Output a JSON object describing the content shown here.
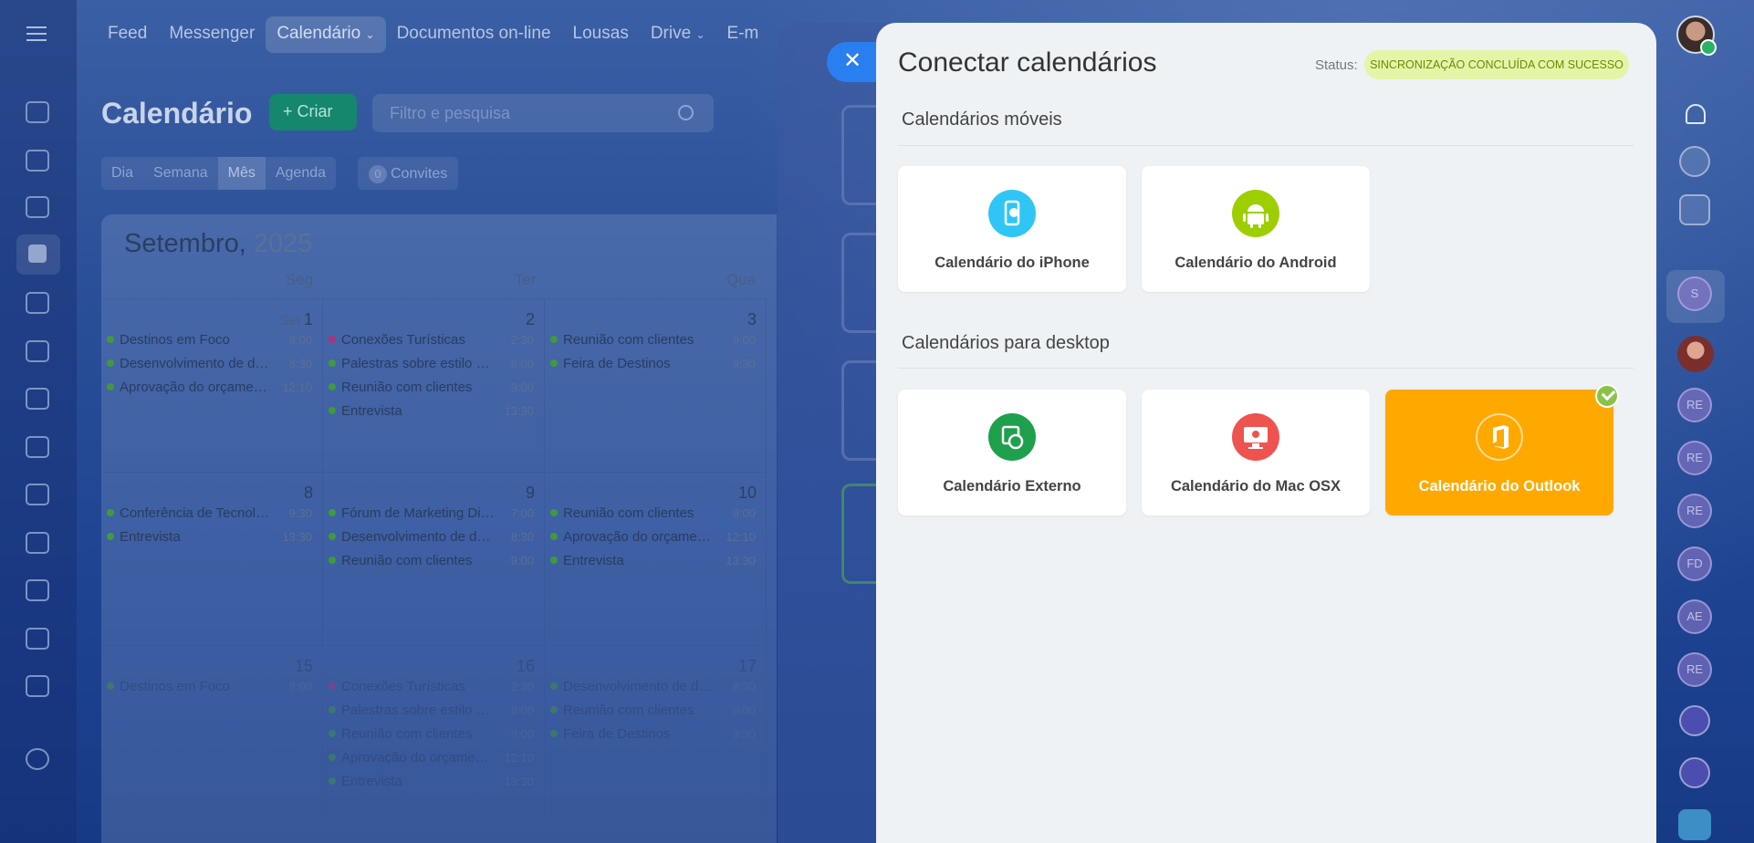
{
  "topnav": [
    "Feed",
    "Messenger",
    "Calendário",
    "Documentos on-line",
    "Lousas",
    "Drive",
    "E-m"
  ],
  "calendar": {
    "title": "Calendário",
    "create_label": "Criar",
    "search_placeholder": "Filtro e pesquisa",
    "views": [
      "Dia",
      "Semana",
      "Mês",
      "Agenda"
    ],
    "invites_count": "0",
    "invites_label": "Convites",
    "month": "Setembro,",
    "year": "2025",
    "weekdays": [
      "Seg",
      "Ter",
      "Qua"
    ],
    "month_short": "Set",
    "days": [
      {
        "num": "1",
        "events": [
          {
            "name": "Destinos em Foco",
            "time": "8:00"
          },
          {
            "name": "Desenvolvimento de doc...",
            "time": "8:30"
          },
          {
            "name": "Aprovação do orçament...",
            "time": "12:10"
          }
        ]
      },
      {
        "num": "2",
        "events": [
          {
            "name": "Conexões Turísticas",
            "time": "2:30",
            "color": "pink"
          },
          {
            "name": "Palestras sobre estilo de ...",
            "time": "8:00"
          },
          {
            "name": "Reunião com clientes",
            "time": "9:00"
          },
          {
            "name": "Entrevista",
            "time": "13:30"
          }
        ]
      },
      {
        "num": "3",
        "events": [
          {
            "name": "Reunião com clientes",
            "time": "9:00"
          },
          {
            "name": "Feira de Destinos",
            "time": "9:30"
          }
        ]
      },
      {
        "num": "8",
        "events": [
          {
            "name": "Conferência de Tecnologi...",
            "time": "9:30"
          },
          {
            "name": "Entrevista",
            "time": "13:30"
          }
        ]
      },
      {
        "num": "9",
        "events": [
          {
            "name": "Fórum de Marketing Digi...",
            "time": "7:00"
          },
          {
            "name": "Desenvolvimento de doc...",
            "time": "8:30"
          },
          {
            "name": "Reunião com clientes",
            "time": "9:00"
          }
        ]
      },
      {
        "num": "10",
        "events": [
          {
            "name": "Reunião com clientes",
            "time": "9:00"
          },
          {
            "name": "Aprovação do orçament...",
            "time": "12:10"
          },
          {
            "name": "Entrevista",
            "time": "13:30"
          }
        ]
      },
      {
        "num": "15",
        "events": [
          {
            "name": "Destinos em Foco",
            "time": "8:00"
          }
        ]
      },
      {
        "num": "16",
        "events": [
          {
            "name": "Conexões Turísticas",
            "time": "2:30",
            "color": "pink"
          },
          {
            "name": "Palestras sobre estilo de ...",
            "time": "8:00"
          },
          {
            "name": "Reunião com clientes",
            "time": "9:00"
          },
          {
            "name": "Aprovação do orçament...",
            "time": "12:10"
          },
          {
            "name": "Entrevista",
            "time": "13:30"
          }
        ]
      },
      {
        "num": "17",
        "events": [
          {
            "name": "Desenvolvimento de doc...",
            "time": "8:30"
          },
          {
            "name": "Reunião com clientes",
            "time": "9:00"
          },
          {
            "name": "Feira de Destinos",
            "time": "9:30"
          }
        ]
      }
    ]
  },
  "dialog": {
    "title": "Conectar calendários",
    "status_label": "Status:",
    "status_value": "SINCRONIZAÇÃO CONCLUÍDA COM SUCESSO",
    "mobile_section": "Calendários móveis",
    "desktop_section": "Calendários para desktop",
    "mobile_cards": [
      {
        "label": "Calendário do iPhone",
        "color": "#2fc6f6",
        "icon": "iphone-icon"
      },
      {
        "label": "Calendário do Android",
        "color": "#9dcf00",
        "icon": "android-icon"
      }
    ],
    "desktop_cards": [
      {
        "label": "Calendário Externo",
        "color": "#1ea04c",
        "icon": "sync-calendar-icon"
      },
      {
        "label": "Calendário do Mac OSX",
        "color": "#ef5350",
        "icon": "mac-icon"
      },
      {
        "label": "Calendário do Outlook",
        "color": "#ffa900",
        "icon": "office-icon",
        "connected": true
      }
    ]
  },
  "rightbar": {
    "avatars": [
      "S",
      "RE",
      "RE",
      "RE",
      "FD",
      "AE",
      "RE"
    ]
  }
}
